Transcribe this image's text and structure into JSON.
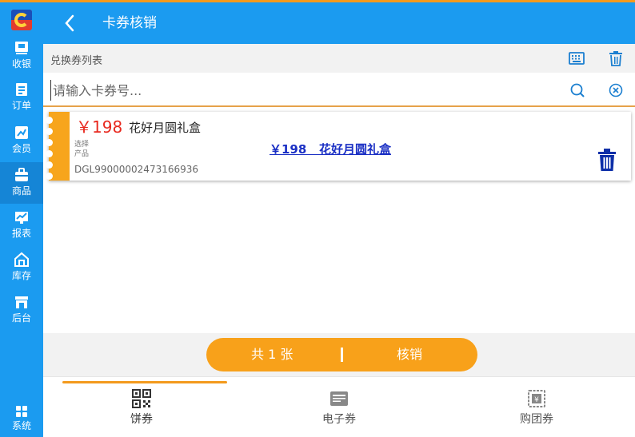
{
  "colors": {
    "accent": "#1b9bf0",
    "orange": "#f8a11a",
    "price_red": "#e8281e",
    "link_blue": "#1a2fc4"
  },
  "sidebar": {
    "items": [
      {
        "label": "收银",
        "icon": "cashier-icon"
      },
      {
        "label": "订单",
        "icon": "order-icon"
      },
      {
        "label": "会员",
        "icon": "member-icon"
      },
      {
        "label": "商品",
        "icon": "goods-icon"
      },
      {
        "label": "报表",
        "icon": "report-icon"
      },
      {
        "label": "库存",
        "icon": "stock-icon"
      },
      {
        "label": "后台",
        "icon": "backstage-icon"
      },
      {
        "label": "系统",
        "icon": "system-grid-icon"
      }
    ],
    "active": "商品"
  },
  "header": {
    "title": "卡券核销"
  },
  "list": {
    "title": "兑换券列表"
  },
  "search": {
    "placeholder": "请输入卡券号..."
  },
  "coupon": {
    "price": "￥198",
    "name": "花好月圆礼盒",
    "select_label": "选择",
    "type_label": "产品",
    "code": "DGL99000002473166936",
    "link": "￥198   花好月圆礼盒"
  },
  "action": {
    "count": "共 1 张",
    "verify": "核销"
  },
  "tabs": [
    {
      "label": "饼券",
      "icon": "qrcode-icon",
      "active": true
    },
    {
      "label": "电子券",
      "icon": "card-icon",
      "active": false
    },
    {
      "label": "购团券",
      "icon": "group-ticket-icon",
      "active": false
    }
  ]
}
